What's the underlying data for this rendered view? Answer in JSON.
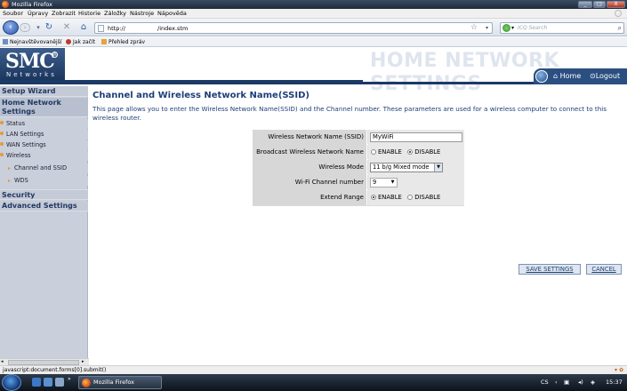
{
  "window": {
    "title": "Mozilla Firefox",
    "controls": [
      "_",
      "□",
      "X"
    ]
  },
  "menu": [
    "Soubor",
    "Úpravy",
    "Zobrazit",
    "Historie",
    "Záložky",
    "Nástroje",
    "Nápověda"
  ],
  "nav": {
    "url_prefix": "http://",
    "url_path": "/index.stm",
    "search_placeholder": "ICQ Search"
  },
  "bookmarks": [
    "Nejnavštěvovanější",
    "Jak začít",
    "Přehled zpráv"
  ],
  "banner": {
    "logo": "SMC",
    "logo_sub": "Networks",
    "reg": "®",
    "title": "HOME NETWORK SETTINGS",
    "home_label": "Home",
    "logout_label": "Logout"
  },
  "sidebar": {
    "setup_wizard": "Setup Wizard",
    "home_network_settings": "Home Network Settings",
    "items": [
      "Status",
      "LAN Settings",
      "WAN Settings",
      "Wireless"
    ],
    "sub_items": [
      "Channel and SSID",
      "WDS"
    ],
    "security": "Security",
    "advanced": "Advanced Settings"
  },
  "main": {
    "heading": "Channel and Wireless Network Name(SSID)",
    "description": "This page allows you to enter the Wireless Network Name(SSID) and the Channel number. These parameters are used for a wireless computer to connect to this wireless router.",
    "fields": {
      "ssid_label": "Wireless Network Name (SSID)",
      "ssid_value": "MyWiFi",
      "broadcast_label": "Broadcast Wireless Network Name",
      "enable": "ENABLE",
      "disable": "DISABLE",
      "mode_label": "Wireless Mode",
      "mode_value": "11 b/g Mixed mode",
      "channel_label": "Wi-Fi Channel number",
      "channel_value": "9",
      "extend_label": "Extend Range",
      "broadcast_selected": "DISABLE",
      "extend_selected": "ENABLE"
    },
    "save_button": "SAVE SETTINGS",
    "cancel_button": "CANCEL"
  },
  "status_bar": {
    "text": "javascript:document.forms[0].submit()"
  },
  "taskbar": {
    "task": "Mozilla Firefox",
    "lang": "CS",
    "time": "15:37"
  },
  "colors": {
    "heading": "#1d3f77",
    "banner_bg": "#1b3a66",
    "sidebar_bg": "#c9cfdb",
    "accent_orange": "#e49a33"
  }
}
